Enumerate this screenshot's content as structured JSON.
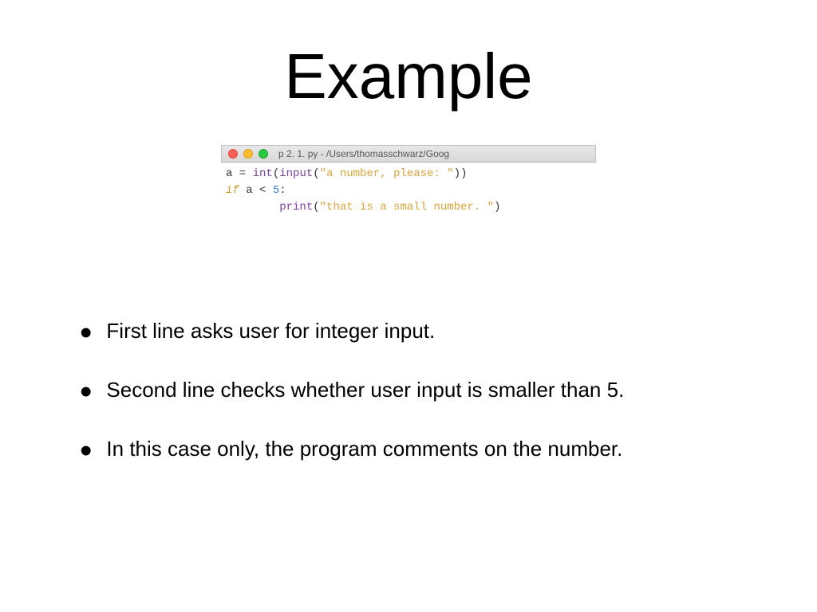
{
  "title": "Example",
  "window": {
    "title": "p 2. 1. py - /Users/thomasschwarz/Goog"
  },
  "code": {
    "line1_var": "a",
    "line1_eq": " = ",
    "line1_int": "int",
    "line1_p1": "(",
    "line1_input": "input",
    "line1_p2": "(",
    "line1_str": "\"a number, please: \"",
    "line1_p3": "))",
    "line2_if": "if",
    "line2_sp": " ",
    "line2_var": "a",
    "line2_lt": " < ",
    "line2_num": "5",
    "line2_colon": ":",
    "line3_indent": "        ",
    "line3_print": "print",
    "line3_p1": "(",
    "line3_str": "\"that is a small number. \"",
    "line3_p2": ")"
  },
  "bullets": [
    "First line asks user for integer input.",
    "Second line checks whether user input is smaller than 5.",
    "In this case only, the program comments on the number."
  ]
}
